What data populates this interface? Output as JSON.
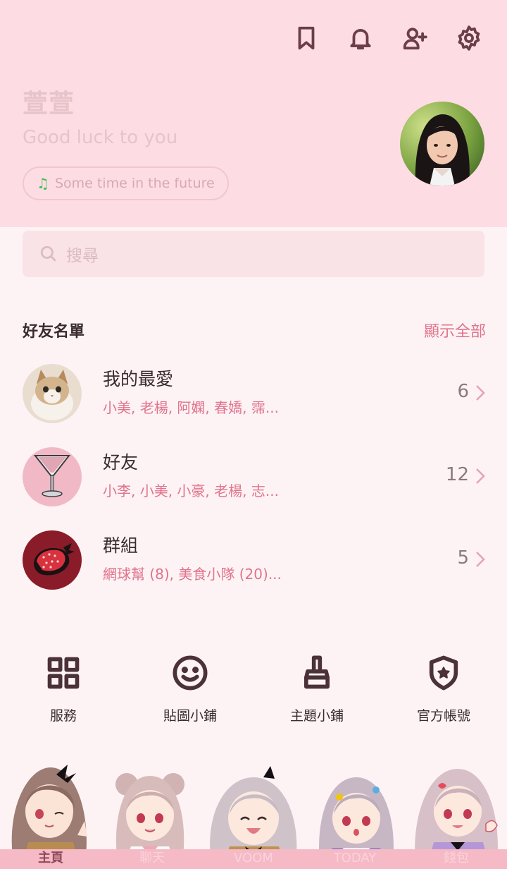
{
  "header": {
    "icons": [
      "bookmark-icon",
      "bell-icon",
      "add-friend-icon",
      "settings-icon"
    ],
    "profile_name": "萱萱",
    "status_message": "Good luck to you",
    "music": "Some time in the future"
  },
  "search": {
    "placeholder": "搜尋"
  },
  "friends_section": {
    "title": "好友名單",
    "show_all": "顯示全部",
    "groups": [
      {
        "title": "我的最愛",
        "members": "小美, 老楊, 阿嫻, 春嬌, 霈...",
        "count": "6"
      },
      {
        "title": "好友",
        "members": "小李, 小美, 小豪, 老楊, 志...",
        "count": "12"
      },
      {
        "title": "群組",
        "members": "網球幫 (8), 美食小隊 (20)...",
        "count": "5"
      }
    ]
  },
  "services": [
    {
      "label": "服務",
      "icon": "grid-icon"
    },
    {
      "label": "貼圖小鋪",
      "icon": "smiley-icon"
    },
    {
      "label": "主題小鋪",
      "icon": "brush-icon"
    },
    {
      "label": "官方帳號",
      "icon": "shield-star-icon"
    }
  ],
  "tabs": [
    {
      "label": "主頁",
      "active": true
    },
    {
      "label": "聊天",
      "active": false
    },
    {
      "label": "VOOM",
      "active": false
    },
    {
      "label": "TODAY",
      "active": false
    },
    {
      "label": "錢包",
      "active": false
    }
  ],
  "colors": {
    "header_bg": "#fddde3",
    "page_bg": "#fdf3f5",
    "accent": "#e1738c",
    "tabbar_bg": "#f6b9c6"
  }
}
